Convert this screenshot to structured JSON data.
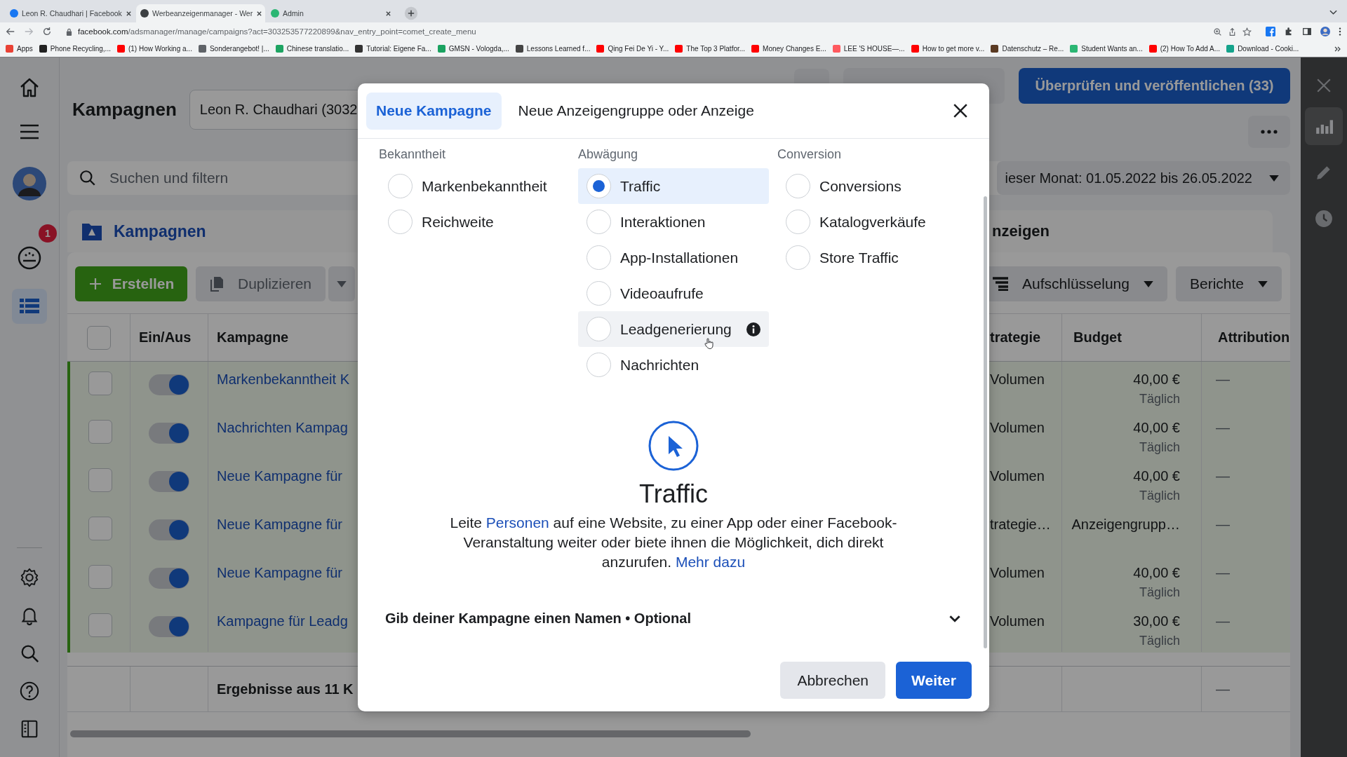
{
  "browser": {
    "tabs": [
      {
        "title": "Leon R. Chaudhari | Facebook",
        "selected": false,
        "color": "#1877f2"
      },
      {
        "title": "Werbeanzeigenmanager - Wer",
        "selected": true,
        "color": "#3c4043"
      },
      {
        "title": "Admin",
        "selected": false,
        "color": "#2bb673"
      }
    ],
    "url_host": "facebook.com",
    "url_path": "/adsmanager/manage/campaigns?act=303253577220899&nav_entry_point=comet_create_menu",
    "bookmarks": [
      {
        "label": "Apps",
        "color": "#e94235"
      },
      {
        "label": "Phone Recycling,...",
        "color": "#222222"
      },
      {
        "label": "(1) How Working a...",
        "color": "#ff0000"
      },
      {
        "label": "Sonderangebot! |...",
        "color": "#5f6368"
      },
      {
        "label": "Chinese translatio...",
        "color": "#1da462"
      },
      {
        "label": "Tutorial: Eigene Fa...",
        "color": "#333333"
      },
      {
        "label": "GMSN - Vologda,...",
        "color": "#1aa260"
      },
      {
        "label": "Lessons Learned f...",
        "color": "#444444"
      },
      {
        "label": "Qing Fei De Yi - Y...",
        "color": "#ff0000"
      },
      {
        "label": "The Top 3 Platfor...",
        "color": "#ff0000"
      },
      {
        "label": "Money Changes E...",
        "color": "#ff0000"
      },
      {
        "label": "LEE 'S HOUSE—...",
        "color": "#ff5a5f"
      },
      {
        "label": "How to get more v...",
        "color": "#ff0000"
      },
      {
        "label": "Datenschutz – Re...",
        "color": "#5a3a22"
      },
      {
        "label": "Student Wants an...",
        "color": "#2bb673"
      },
      {
        "label": "(2) How To Add A...",
        "color": "#ff0000"
      },
      {
        "label": "Download - Cooki...",
        "color": "#14a38b"
      }
    ]
  },
  "nav": [
    {
      "selected": false
    },
    {
      "selected": false
    },
    {
      "selected": false
    },
    {
      "selected": false,
      "badge": "1"
    },
    {
      "selected": true
    }
  ],
  "header": {
    "title": "Kampagnen",
    "account": "Leon R. Chaudhari (3032",
    "publish": "Überprüfen und veröffentlichen (33)"
  },
  "search": {
    "placeholder": "Suchen und filtern",
    "date_range": "ieser Monat: 01.05.2022 bis 26.05.2022"
  },
  "level_tabs": [
    {
      "label": "Kampagnen",
      "selected": true
    },
    {
      "label": "nzeigen",
      "selected": false
    }
  ],
  "toolbar": {
    "create": "Erstellen",
    "duplicate": "Duplizieren",
    "breakdown": "Aufschlüsselung",
    "reports": "Berichte"
  },
  "table": {
    "select_all_checked": false,
    "columns": [
      "Ein/Aus",
      "Kampagne",
      "trategie",
      "Budget",
      "Attribution"
    ],
    "rows": [
      {
        "checked": false,
        "on": true,
        "name": "Markenbekanntheit K",
        "strategy": "Volumen",
        "budget": "40,00 €",
        "period": "Täglich",
        "attribution": "—"
      },
      {
        "checked": false,
        "on": true,
        "name": "Nachrichten Kampag",
        "strategy": "Volumen",
        "budget": "40,00 €",
        "period": "Täglich",
        "attribution": "—"
      },
      {
        "checked": false,
        "on": true,
        "name": "Neue Kampagne für",
        "strategy": "Volumen",
        "budget": "40,00 €",
        "period": "Täglich",
        "attribution": "—"
      },
      {
        "checked": false,
        "on": true,
        "name": "Neue Kampagne für",
        "strategy": "trategie…",
        "budget": "Anzeigengrupp…",
        "attribution": "—"
      },
      {
        "checked": false,
        "on": true,
        "name": "Neue Kampagne für",
        "strategy": "Volumen",
        "budget": "40,00 €",
        "period": "Täglich",
        "attribution": "—"
      },
      {
        "checked": false,
        "on": true,
        "name": "Kampagne für Leadg",
        "strategy": "Volumen",
        "budget": "30,00 €",
        "period": "Täglich",
        "attribution": "—"
      }
    ],
    "footer": {
      "results": "Ergebnisse aus 11 K",
      "attribution": "—"
    }
  },
  "right_panel": [
    {
      "selected": true
    },
    {
      "selected": false
    },
    {
      "selected": false
    }
  ],
  "modal": {
    "tabs": [
      {
        "label": "Neue Kampagne",
        "selected": true
      },
      {
        "label": "Neue Anzeigengruppe oder Anzeige",
        "selected": false
      }
    ],
    "groups": [
      {
        "heading": "Bekanntheit",
        "options": [
          {
            "label": "Markenbekanntheit",
            "selected": false,
            "hovered": false,
            "info": false
          },
          {
            "label": "Reichweite",
            "selected": false,
            "hovered": false,
            "info": false
          }
        ]
      },
      {
        "heading": "Abwägung",
        "options": [
          {
            "label": "Traffic",
            "selected": true,
            "hovered": false,
            "info": false
          },
          {
            "label": "Interaktionen",
            "selected": false,
            "hovered": false,
            "info": false
          },
          {
            "label": "App-Installationen",
            "selected": false,
            "hovered": false,
            "info": false
          },
          {
            "label": "Videoaufrufe",
            "selected": false,
            "hovered": false,
            "info": false
          },
          {
            "label": "Leadgenerierung",
            "selected": false,
            "hovered": true,
            "info": true
          },
          {
            "label": "Nachrichten",
            "selected": false,
            "hovered": false,
            "info": false
          }
        ]
      },
      {
        "heading": "Conversion",
        "options": [
          {
            "label": "Conversions",
            "selected": false,
            "hovered": false,
            "info": false
          },
          {
            "label": "Katalogverkäufe",
            "selected": false,
            "hovered": false,
            "info": false
          },
          {
            "label": "Store Traffic",
            "selected": false,
            "hovered": false,
            "info": false
          }
        ]
      }
    ],
    "detail": {
      "title": "Traffic",
      "description": [
        {
          "kind": "text",
          "text": "Leite "
        },
        {
          "kind": "link",
          "text": "Personen"
        },
        {
          "kind": "text",
          "text": " auf eine Website, zu einer App oder einer Facebook-Veranstaltung weiter oder biete ihnen die Möglichkeit, dich direkt anzurufen. "
        },
        {
          "kind": "link",
          "text": "Mehr dazu"
        }
      ]
    },
    "name_section": {
      "label": "Gib deiner Kampagne einen Namen • Optional",
      "expanded": false
    },
    "cancel": "Abbrechen",
    "next": "Weiter"
  }
}
